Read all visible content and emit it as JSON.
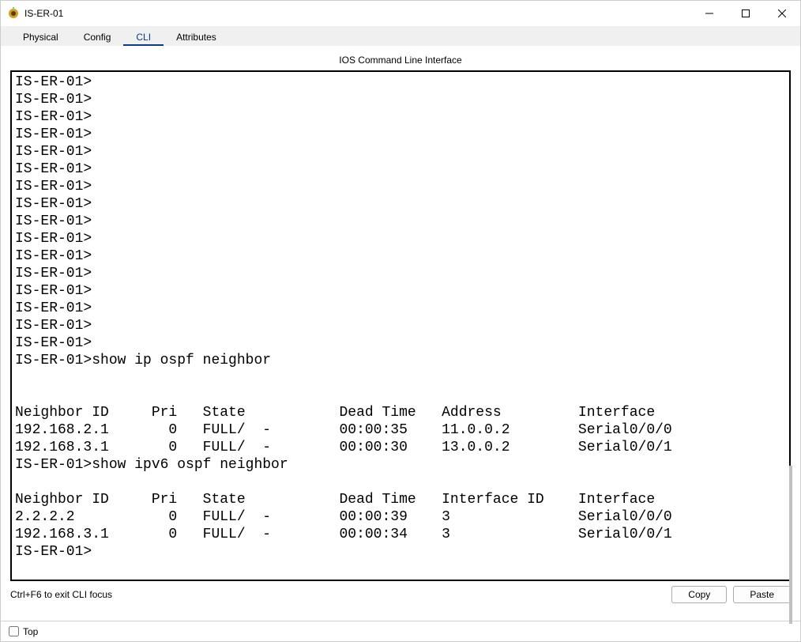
{
  "window": {
    "title": "IS-ER-01"
  },
  "tabs": {
    "physical": "Physical",
    "config": "Config",
    "cli": "CLI",
    "attributes": "Attributes",
    "active": "cli"
  },
  "cli": {
    "heading": "IOS Command Line Interface",
    "content": "IS-ER-01>\nIS-ER-01>\nIS-ER-01>\nIS-ER-01>\nIS-ER-01>\nIS-ER-01>\nIS-ER-01>\nIS-ER-01>\nIS-ER-01>\nIS-ER-01>\nIS-ER-01>\nIS-ER-01>\nIS-ER-01>\nIS-ER-01>\nIS-ER-01>\nIS-ER-01>\nIS-ER-01>show ip ospf neighbor\n\n\nNeighbor ID     Pri   State           Dead Time   Address         Interface\n192.168.2.1       0   FULL/  -        00:00:35    11.0.0.2        Serial0/0/0\n192.168.3.1       0   FULL/  -        00:00:30    13.0.0.2        Serial0/0/1\nIS-ER-01>show ipv6 ospf neighbor\n\nNeighbor ID     Pri   State           Dead Time   Interface ID    Interface\n2.2.2.2           0   FULL/  -        00:00:39    3               Serial0/0/0\n192.168.3.1       0   FULL/  -        00:00:34    3               Serial0/0/1\nIS-ER-01>"
  },
  "footer": {
    "hint": "Ctrl+F6 to exit CLI focus",
    "copy": "Copy",
    "paste": "Paste"
  },
  "statusbar": {
    "top_label": "Top",
    "top_checked": false
  }
}
